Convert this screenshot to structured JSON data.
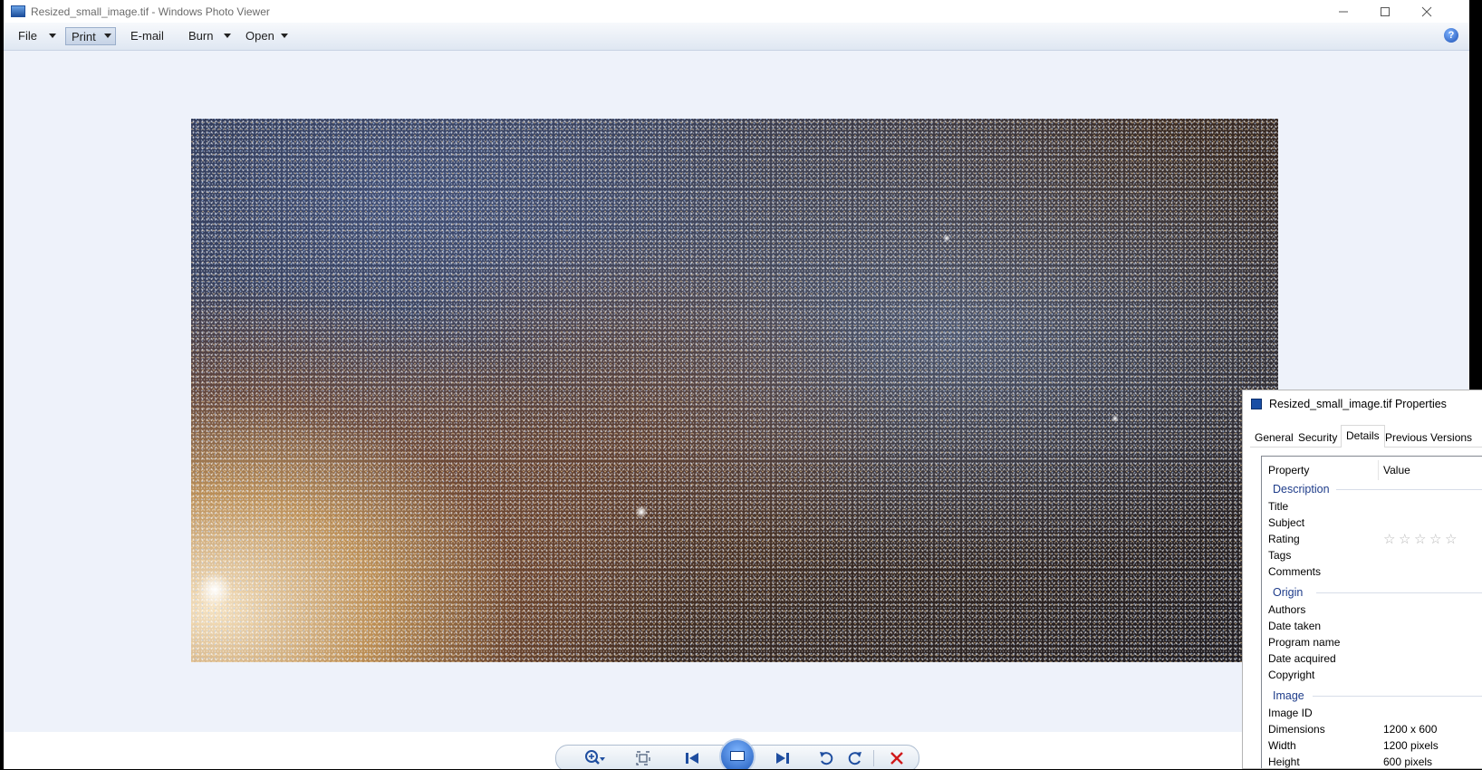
{
  "window": {
    "title": "Resized_small_image.tif - Windows Photo Viewer",
    "controls": [
      "minimize",
      "maximize",
      "close"
    ]
  },
  "menu": {
    "file": "File",
    "print": "Print",
    "email": "E-mail",
    "burn": "Burn",
    "open": "Open",
    "help_glyph": "?"
  },
  "toolbar": {
    "zoom": "zoom-icon",
    "fit": "actual-size-icon",
    "previous": "previous-icon",
    "slideshow": "slideshow-icon",
    "next": "next-icon",
    "rotate_ccw": "rotate-counterclockwise-icon",
    "rotate_cw": "rotate-clockwise-icon",
    "delete": "delete-icon"
  },
  "dialog": {
    "title": "Resized_small_image.tif Properties",
    "tabs": [
      "General",
      "Security",
      "Details",
      "Previous Versions"
    ],
    "active_tab": "Details",
    "columns": {
      "property": "Property",
      "value": "Value"
    },
    "groups": {
      "description": {
        "label": "Description",
        "rows": [
          {
            "property": "Title",
            "value": ""
          },
          {
            "property": "Subject",
            "value": ""
          },
          {
            "property": "Rating",
            "value": ""
          },
          {
            "property": "Tags",
            "value": ""
          },
          {
            "property": "Comments",
            "value": ""
          }
        ]
      },
      "origin": {
        "label": "Origin",
        "rows": [
          {
            "property": "Authors",
            "value": ""
          },
          {
            "property": "Date taken",
            "value": ""
          },
          {
            "property": "Program name",
            "value": ""
          },
          {
            "property": "Date acquired",
            "value": ""
          },
          {
            "property": "Copyright",
            "value": ""
          }
        ]
      },
      "image": {
        "label": "Image",
        "rows": [
          {
            "property": "Image ID",
            "value": ""
          },
          {
            "property": "Dimensions",
            "value": "1200 x 600"
          },
          {
            "property": "Width",
            "value": "1200 pixels"
          },
          {
            "property": "Height",
            "value": "600 pixels"
          }
        ]
      }
    },
    "rating_stars": 0,
    "rating_max": 5
  },
  "colors": {
    "accent": "#1b56b8",
    "group_heading": "#1e3c8a",
    "delete": "#d0191b"
  }
}
